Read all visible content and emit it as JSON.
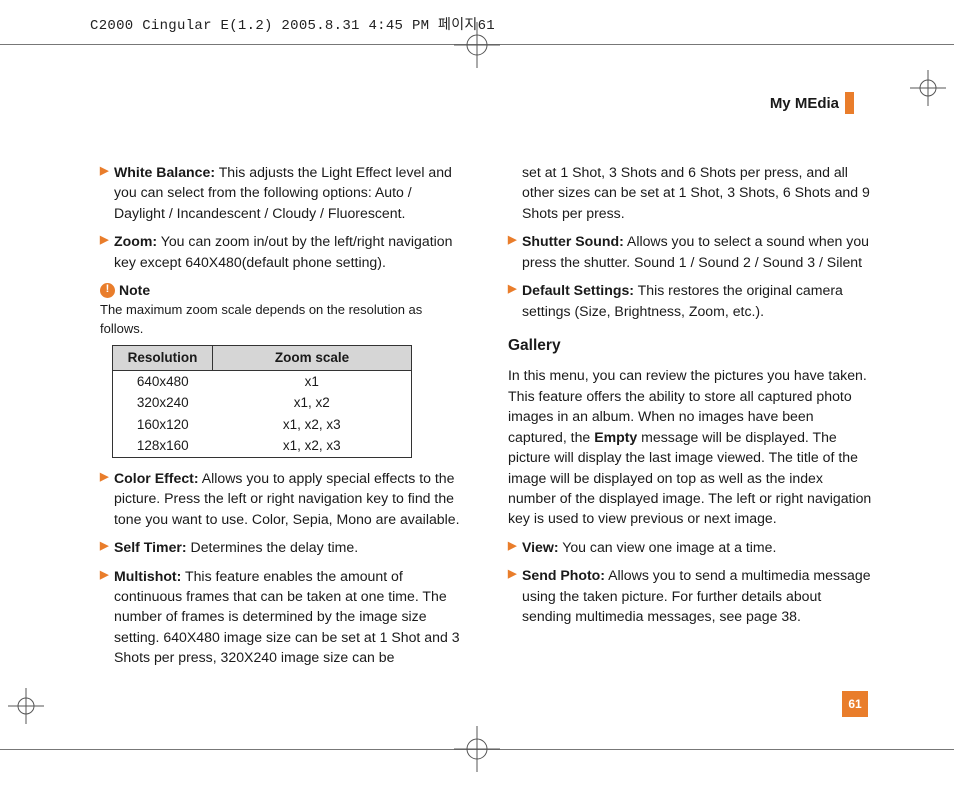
{
  "print_header": "C2000 Cingular E(1.2) 2005.8.31 4:45 PM 페이지61",
  "section_title": "My MEdia",
  "page_number": "61",
  "chart_data": {
    "type": "table",
    "columns": [
      "Resolution",
      "Zoom scale"
    ],
    "rows": [
      [
        "640x480",
        "x1"
      ],
      [
        "320x240",
        "x1,  x2"
      ],
      [
        "160x120",
        "x1,  x2,  x3"
      ],
      [
        "128x160",
        "x1,  x2,  x3"
      ]
    ]
  },
  "left": {
    "white_balance_label": "White Balance:",
    "white_balance_text": " This adjusts the Light Effect level and you can select from the following options: Auto / Daylight / Incandescent / Cloudy / Fluorescent.",
    "zoom_label": "Zoom:",
    "zoom_text": " You can zoom in/out by the left/right navigation key except 640X480(default phone setting).",
    "note_label": "Note",
    "note_text": "The maximum zoom scale depends on the resolution as follows.",
    "color_effect_label": "Color Effect:",
    "color_effect_text": " Allows you to apply special effects to the picture. Press the left or right navigation key to find the tone you want to use. Color, Sepia, Mono are available.",
    "self_timer_label": "Self Timer:",
    "self_timer_text": " Determines the delay time.",
    "multishot_label": "Multishot:",
    "multishot_text": " This feature enables the amount of continuous frames that can be taken at one time. The number of frames is determined by the image size setting. 640X480 image size can be set at 1 Shot and 3 Shots per press, 320X240 image size can be"
  },
  "right": {
    "multishot_cont": "set at 1 Shot, 3 Shots and 6 Shots per press, and all other sizes can be set at 1 Shot, 3 Shots, 6 Shots and 9 Shots per press.",
    "shutter_label": "Shutter Sound:",
    "shutter_text": " Allows you to select a sound when you press the shutter. Sound 1 / Sound 2 / Sound 3 / Silent",
    "defaults_label": "Default Settings:",
    "defaults_text": " This restores the original camera settings (Size, Brightness, Zoom, etc.).",
    "gallery_heading": "Gallery",
    "gallery_p1a": "In this menu, you can review the pictures you have taken. This feature offers the ability to store all captured photo images in an album. When no images have been captured, the ",
    "gallery_empty": "Empty",
    "gallery_p1b": " message will be displayed. The picture will display the last image viewed. The title of the image will be displayed on top as well as the index number of the displayed image. The left or right navigation key is used to view previous or next image.",
    "view_label": "View:",
    "view_text": " You can view one image at a time.",
    "sendphoto_label": "Send Photo:",
    "sendphoto_text": " Allows you to send a multimedia message using the taken picture. For further details about sending multimedia messages, see page 38."
  }
}
